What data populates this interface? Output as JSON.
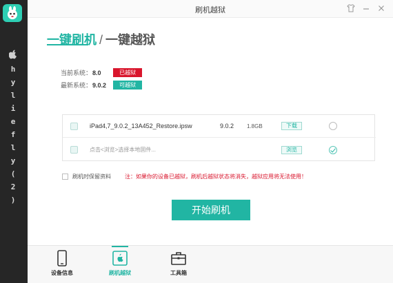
{
  "window": {
    "title": "刷机越狱",
    "controls": [
      "shirt-icon",
      "minimize-icon",
      "close-icon"
    ]
  },
  "sidebar": {
    "apple_icon": "apple-icon",
    "letters": [
      "h",
      "y",
      "l",
      "i",
      "e",
      "f",
      "l",
      "y",
      "(",
      "2",
      ")"
    ]
  },
  "heading": {
    "active": "一键刷机",
    "separator": "/",
    "inactive": "一键越狱"
  },
  "system": {
    "current_label": "当前系统：",
    "current_version": "8.0",
    "current_status": "已越狱",
    "latest_label": "最新系统：",
    "latest_version": "9.0.2",
    "latest_status": "可越狱"
  },
  "firmware": {
    "rows": [
      {
        "name": "iPad4,7_9.0.2_13A452_Restore.ipsw",
        "version": "9.0.2",
        "size": "1.8GB",
        "action": "下载",
        "selected": false
      },
      {
        "name": "点击<浏览>选择本地固件...",
        "version": "",
        "size": "",
        "action": "浏览",
        "selected": true
      }
    ]
  },
  "options": {
    "keep_data_label": "刷机时保留资料",
    "warning": "注：如果你的设备已越狱，刷机后越狱状态将消失，越狱应用将无法使用！"
  },
  "start_button": "开始刷机",
  "toolbar": {
    "device_info": "设备信息",
    "jailbreak": "刷机越狱",
    "toolbox": "工具箱"
  },
  "colors": {
    "accent": "#21b5a3",
    "danger": "#d9162d",
    "sidebar": "#262626"
  }
}
